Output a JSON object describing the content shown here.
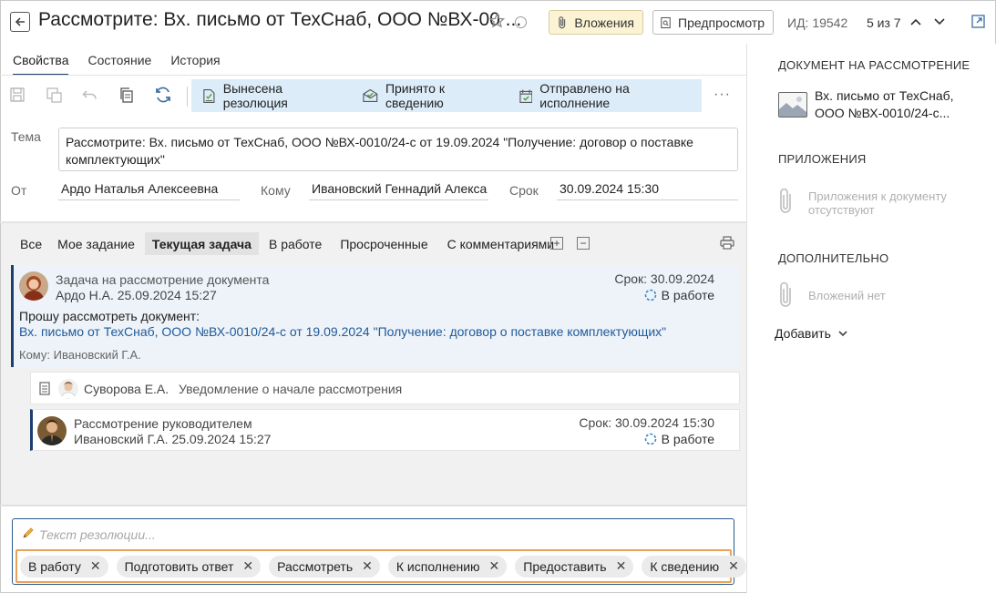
{
  "header": {
    "title": "Рассмотрите: Вх. письмо от ТехСнаб, ООО №ВХ-00 ...",
    "attachments_label": "Вложения",
    "preview_label": "Предпросмотр",
    "id_text": "ИД: 19542",
    "pager_text": "5 из 7"
  },
  "tabs": [
    {
      "label": "Свойства",
      "active": true
    },
    {
      "label": "Состояние",
      "active": false
    },
    {
      "label": "История",
      "active": false
    }
  ],
  "toolbar": {
    "actions": [
      {
        "label": "Вынесена резолюция",
        "icon": "resolution-icon"
      },
      {
        "label": "Принято к сведению",
        "icon": "acknowledged-icon"
      },
      {
        "label": "Отправлено на исполнение",
        "icon": "calendar-check-icon"
      }
    ],
    "more": "···"
  },
  "form": {
    "subject_label": "Тема",
    "subject_value": "Рассмотрите: Вх. письмо от ТехСнаб, ООО №ВХ-0010/24-с от 19.09.2024 \"Получение: договор о поставке комплектующих\"",
    "from_label": "От",
    "from_value": "Ардо Наталья Алексеевна",
    "to_label": "Кому",
    "to_value": "Ивановский Геннадий Алекса",
    "due_label": "Срок",
    "due_value": "30.09.2024 15:30"
  },
  "filters": [
    {
      "label": "Все",
      "active": false
    },
    {
      "label": "Мое задание",
      "active": false
    },
    {
      "label": "Текущая задача",
      "active": true
    },
    {
      "label": "В работе",
      "active": false
    },
    {
      "label": "Просроченные",
      "active": false
    },
    {
      "label": "С комментариями",
      "active": false
    }
  ],
  "tasks": {
    "main": {
      "title": "Задача на рассмотрение документа",
      "author_date": "Ардо Н.А.  25.09.2024 15:27",
      "due": "Срок: 30.09.2024",
      "status": "В работе",
      "body": "Прошу рассмотреть документ:",
      "link": "Вх. письмо от ТехСнаб, ООО №ВХ-0010/24-с от 19.09.2024 \"Получение: договор о поставке комплектующих\"",
      "to": "Кому: Ивановский Г.А."
    },
    "notice": {
      "author": "Суворова Е.А.",
      "text": "Уведомление о начале рассмотрения"
    },
    "review": {
      "title": "Рассмотрение руководителем",
      "author_date": "Ивановский Г.А.  25.09.2024 15:27",
      "due": "Срок: 30.09.2024 15:30",
      "status": "В работе"
    }
  },
  "resolution": {
    "placeholder": "Текст резолюции...",
    "chips": [
      "В работу",
      "Подготовить ответ",
      "Рассмотреть",
      "К исполнению",
      "Предоставить",
      "К сведению"
    ]
  },
  "right_panel": {
    "doc_heading": "ДОКУМЕНТ НА РАССМОТРЕНИЕ",
    "doc_title_line1": "Вх. письмо от ТехСнаб,",
    "doc_title_line2": "ООО №ВХ-0010/24-с...",
    "attachments_heading": "ПРИЛОЖЕНИЯ",
    "attachments_empty_line1": "Приложения к документу",
    "attachments_empty_line2": "отсутствуют",
    "extra_heading": "ДОПОЛНИТЕЛЬНО",
    "extra_empty": "Вложений нет",
    "add_label": "Добавить"
  },
  "colors": {
    "accent": "#1c3f6e",
    "action_band": "#dcecf8",
    "link": "#1f5a99",
    "attachments_button": "#fbf3d4",
    "chips_outline": "#e8a25a",
    "status_icon": "#3a86c8"
  }
}
